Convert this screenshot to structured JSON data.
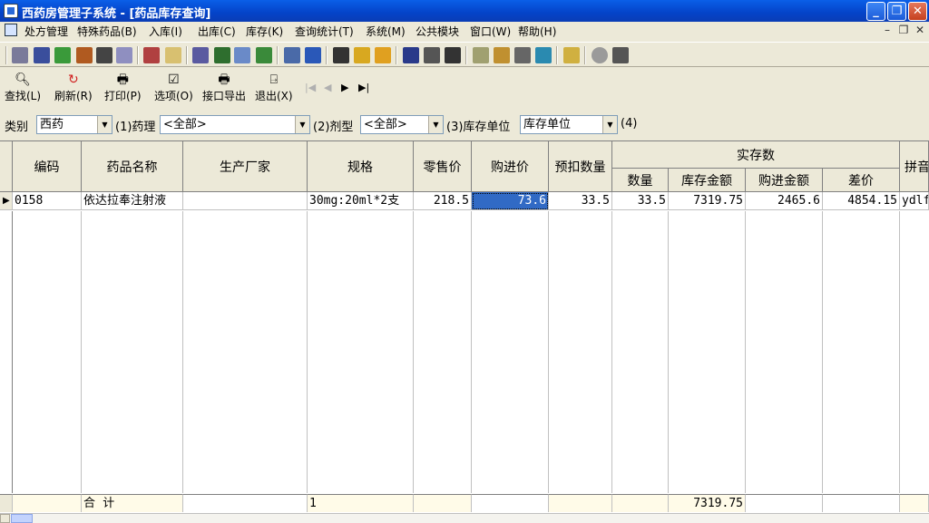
{
  "window": {
    "title": "西药房管理子系统 - [药品库存查询]"
  },
  "menu": [
    "处方管理",
    "特殊药品(B)",
    "入库(I)",
    "出库(C)",
    "库存(K)",
    "查询统计(T)",
    "系统(M)",
    "公共模块",
    "窗口(W)",
    "帮助(H)"
  ],
  "toolbar2": {
    "buttons": [
      {
        "label": "查找(L)",
        "icon": "magnifier-icon"
      },
      {
        "label": "刷新(R)",
        "icon": "refresh-icon"
      },
      {
        "label": "打印(P)",
        "icon": "printer-icon"
      },
      {
        "label": "选项(O)",
        "icon": "options-icon"
      },
      {
        "label": "接口导出",
        "icon": "printer-export-icon"
      },
      {
        "label": "退出(X)",
        "icon": "exit-door-icon"
      }
    ]
  },
  "filters": {
    "category_label": "类别",
    "category_value": "西药",
    "pharm_label": "(1)药理",
    "pharm_value": "<全部>",
    "form_label": "(2)剂型",
    "form_value": "<全部>",
    "unit_label": "(3)库存单位",
    "unit_value": "库存单位",
    "extra_label": "(4)"
  },
  "grid": {
    "headers": {
      "code": "编码",
      "name": "药品名称",
      "maker": "生产厂家",
      "spec": "规格",
      "retail": "零售价",
      "purchase": "购进价",
      "reserved": "预扣数量",
      "actual_group": "实存数",
      "qty": "数量",
      "stock_amount": "库存金额",
      "purchase_amount": "购进金额",
      "diff": "差价",
      "pinyin": "拼音"
    },
    "rows": [
      {
        "code": "0158",
        "name": "依达拉奉注射液",
        "maker": "",
        "spec": "30mg:20ml*2支",
        "retail": "218.5",
        "purchase": "73.6",
        "reserved": "33.5",
        "qty": "33.5",
        "stock_amount": "7319.75",
        "purchase_amount": "2465.6",
        "diff": "4854.15",
        "pinyin": "ydlf"
      }
    ],
    "footer": {
      "label": "合  计",
      "spec": "1",
      "stock_amount": "7319.75"
    }
  }
}
